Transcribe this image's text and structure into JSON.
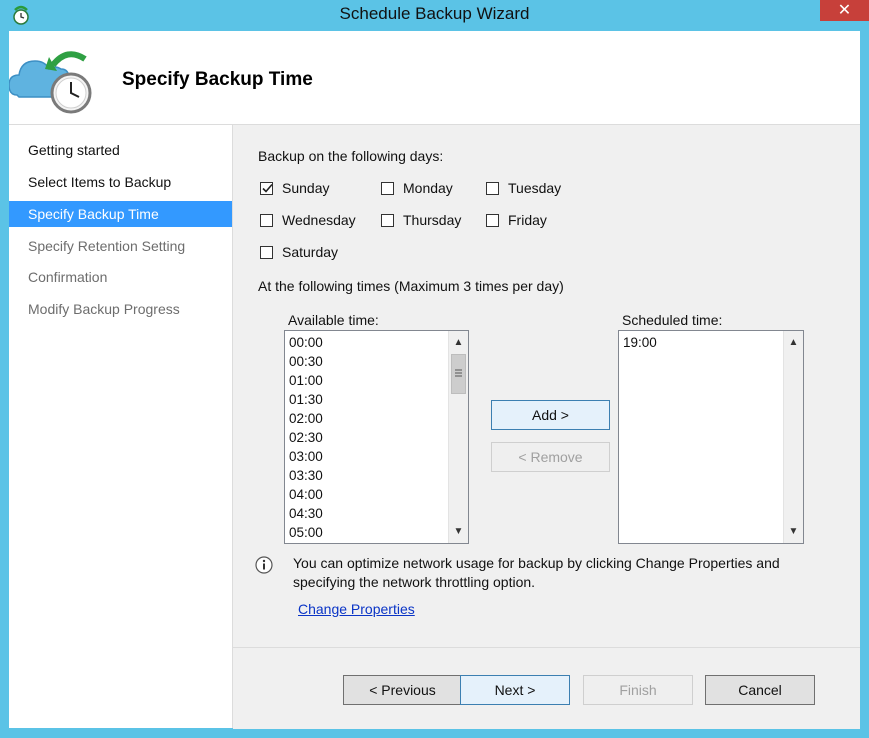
{
  "window": {
    "title": "Schedule Backup Wizard",
    "close_glyph": "✕"
  },
  "header": {
    "title": "Specify Backup Time",
    "icon": "cloud-clock-icon"
  },
  "sidebar": {
    "items": [
      {
        "label": "Getting started",
        "state": "done"
      },
      {
        "label": "Select Items to Backup",
        "state": "done"
      },
      {
        "label": "Specify Backup Time",
        "state": "active"
      },
      {
        "label": "Specify Retention Setting",
        "state": "future"
      },
      {
        "label": "Confirmation",
        "state": "future"
      },
      {
        "label": "Modify Backup Progress",
        "state": "future"
      }
    ]
  },
  "days": {
    "label": "Backup on the following days:",
    "items": [
      {
        "label": "Sunday",
        "checked": true
      },
      {
        "label": "Monday",
        "checked": false
      },
      {
        "label": "Tuesday",
        "checked": false
      },
      {
        "label": "Wednesday",
        "checked": false
      },
      {
        "label": "Thursday",
        "checked": false
      },
      {
        "label": "Friday",
        "checked": false
      },
      {
        "label": "Saturday",
        "checked": false
      }
    ]
  },
  "times": {
    "label": "At the following times (Maximum 3 times per day)",
    "available_label": "Available time:",
    "available": [
      "00:00",
      "00:30",
      "01:00",
      "01:30",
      "02:00",
      "02:30",
      "03:00",
      "03:30",
      "04:00",
      "04:30",
      "05:00"
    ],
    "scheduled_label": "Scheduled time:",
    "scheduled": [
      "19:00"
    ],
    "add_label": "Add >",
    "remove_label": "< Remove"
  },
  "info": {
    "line1": "You can optimize network usage for backup by clicking Change Properties and",
    "line2": "specifying the network throttling option.",
    "link": "Change Properties"
  },
  "footer": {
    "previous": "< Previous",
    "next": "Next >",
    "finish": "Finish",
    "cancel": "Cancel"
  },
  "colors": {
    "accent": "#3399ff",
    "titlebar": "#5bc3e6",
    "close": "#c7403a",
    "link": "#0a34c6"
  }
}
